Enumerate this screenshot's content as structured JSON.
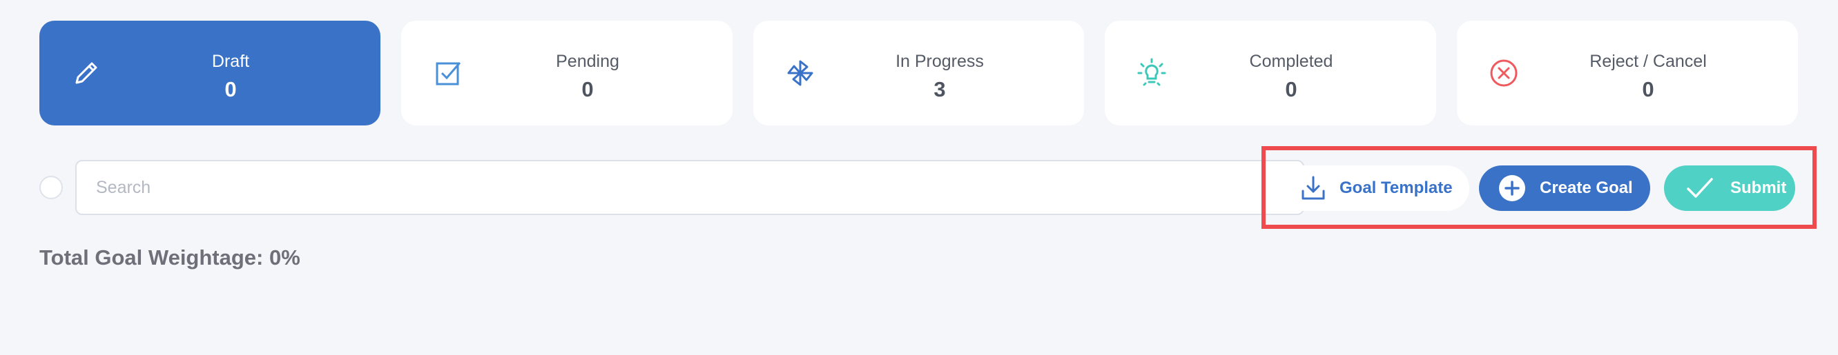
{
  "status_cards": [
    {
      "label": "Draft",
      "count": "0",
      "icon": "pencil-icon",
      "active": true
    },
    {
      "label": "Pending",
      "count": "0",
      "icon": "checkbox-icon"
    },
    {
      "label": "In Progress",
      "count": "3",
      "icon": "pinwheel-icon"
    },
    {
      "label": "Completed",
      "count": "0",
      "icon": "lightbulb-icon"
    },
    {
      "label": "Reject / Cancel",
      "count": "0",
      "icon": "cancel-circle-icon"
    }
  ],
  "search": {
    "placeholder": "Search",
    "value": ""
  },
  "actions": {
    "goal_template_label": "Goal Template",
    "create_goal_label": "Create Goal",
    "submit_label": "Submit"
  },
  "total_weightage": "Total Goal Weightage: 0%",
  "colors": {
    "primary": "#3a72c8",
    "accent_teal": "#4fd1c5",
    "danger": "#ef4a4e",
    "background": "#f5f6fa"
  }
}
